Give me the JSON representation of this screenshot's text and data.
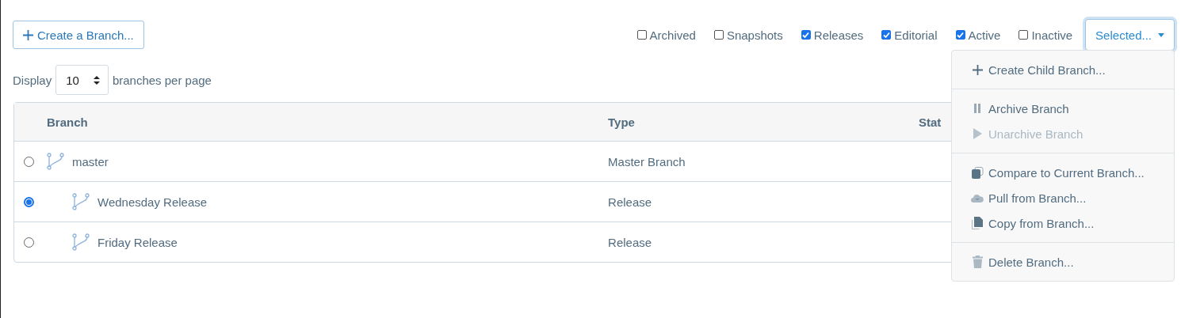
{
  "create_button": {
    "kind": "plus",
    "label": "Create a Branch..."
  },
  "filters": [
    {
      "label": "Archived",
      "checked": false
    },
    {
      "label": "Snapshots",
      "checked": false
    },
    {
      "label": "Releases",
      "checked": true
    },
    {
      "label": "Editorial",
      "checked": true
    },
    {
      "label": "Active",
      "checked": true
    },
    {
      "label": "Inactive",
      "checked": false
    }
  ],
  "selected_menu": {
    "label": "Selected...",
    "expanded": true,
    "sections": [
      [
        {
          "label": "Create Child Branch...",
          "kind": "plus",
          "disabled": false
        }
      ],
      [
        {
          "label": "Archive Branch",
          "kind": "pause",
          "disabled": false
        },
        {
          "label": "Unarchive Branch",
          "kind": "play",
          "disabled": true
        }
      ],
      [
        {
          "label": "Compare to Current Branch...",
          "kind": "compare",
          "disabled": false
        },
        {
          "label": "Pull from Branch...",
          "kind": "cloud",
          "disabled": false
        },
        {
          "label": "Copy from Branch...",
          "kind": "copy",
          "disabled": false
        }
      ],
      [
        {
          "label": "Delete Branch...",
          "kind": "trash",
          "disabled": false
        }
      ]
    ]
  },
  "page_size": {
    "prefix": "Display",
    "value": "10",
    "suffix": "branches per page"
  },
  "table": {
    "columns": [
      "Branch",
      "Type",
      "Stat"
    ],
    "rows": [
      {
        "name": "master",
        "type": "Master Branch",
        "selected": false,
        "children": [
          {
            "name": "Wednesday Release",
            "type": "Release",
            "selected": true
          },
          {
            "name": "Friday Release",
            "type": "Release",
            "selected": false
          }
        ]
      }
    ]
  }
}
